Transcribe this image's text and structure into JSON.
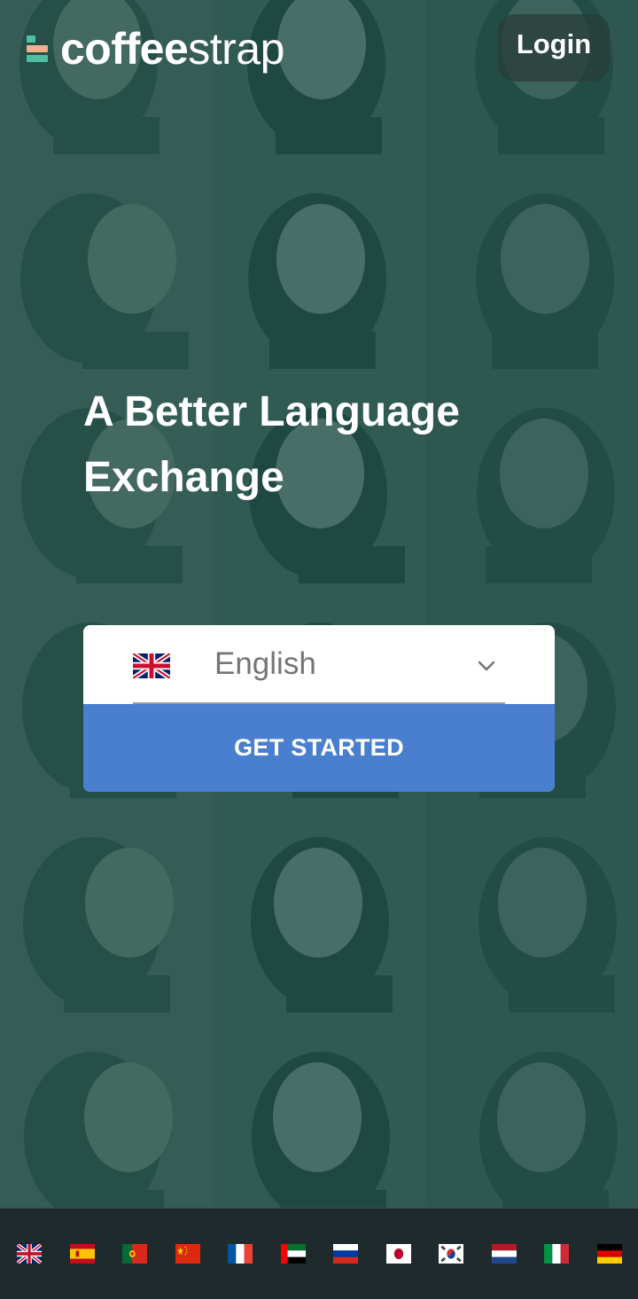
{
  "brand": {
    "name_bold": "coffee",
    "name_light": "strap"
  },
  "header": {
    "login_label": "Login"
  },
  "hero": {
    "headline": "A Better Language Exchange"
  },
  "language_select": {
    "selected": "English",
    "selected_flag_icon": "uk-flag-icon"
  },
  "cta": {
    "label": "GET STARTED"
  },
  "footer": {
    "flags": [
      {
        "icon": "uk-flag-icon"
      },
      {
        "icon": "spain-flag-icon"
      },
      {
        "icon": "portugal-flag-icon"
      },
      {
        "icon": "china-flag-icon"
      },
      {
        "icon": "france-flag-icon"
      },
      {
        "icon": "uae-flag-icon"
      },
      {
        "icon": "russia-flag-icon"
      },
      {
        "icon": "japan-flag-icon"
      },
      {
        "icon": "south-korea-flag-icon"
      },
      {
        "icon": "netherlands-flag-icon"
      },
      {
        "icon": "italy-flag-icon"
      },
      {
        "icon": "germany-flag-icon"
      }
    ]
  },
  "colors": {
    "overlay": "#1f4a44",
    "cta": "#4a7fcf",
    "footer": "#1e2a2c",
    "logo_green": "#4fbfa0",
    "logo_peach": "#f0b08a"
  }
}
